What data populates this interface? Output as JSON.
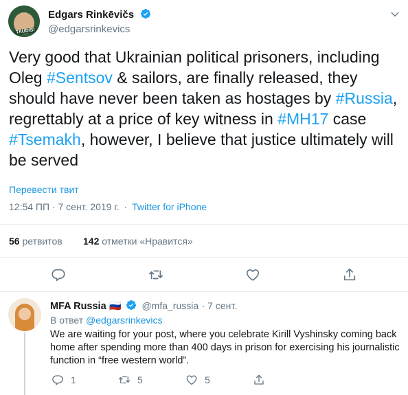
{
  "tweet": {
    "author_name": "Edgars Rinkēvičs",
    "author_handle": "@edgarsrinkevics",
    "avatar_label": "TAUDIS!",
    "text_parts": [
      "Very good that Ukrainian political prisoners, including Oleg ",
      "#Sentsov",
      " & sailors, are finally released, they should have never been taken as hostages by ",
      "#Russia",
      ", regrettably at a price of key witness in ",
      "#MH17",
      " case ",
      "#Tsemakh",
      ", however, I believe that justice ultimately will be served"
    ],
    "translate_label": "Перевести твит",
    "time": "12:54 ПП · 7 сент. 2019 г.",
    "separator": "·",
    "source": "Twitter for iPhone",
    "retweets_count": "56",
    "retweets_label": "ретвитов",
    "likes_count": "142",
    "likes_label": "отметки «Нравится»"
  },
  "reply": {
    "author_name": "MFA Russia",
    "flag": "🇷🇺",
    "author_handle": "@mfa_russia",
    "time": "· 7 сент.",
    "in_reply_prefix": "В ответ",
    "in_reply_handle": "@edgarsrinkevics",
    "text": "We are waiting for your post, where you celebrate Kirill Vyshinsky coming back home after spending more than 400 days in prison for exercising his journalistic function in “free western world”.",
    "reply_count": "1",
    "retweet_count": "5",
    "like_count": "5"
  },
  "colors": {
    "link": "#1b95e0",
    "muted": "#657786",
    "text": "#14171a",
    "divider": "#e6ecf0"
  }
}
